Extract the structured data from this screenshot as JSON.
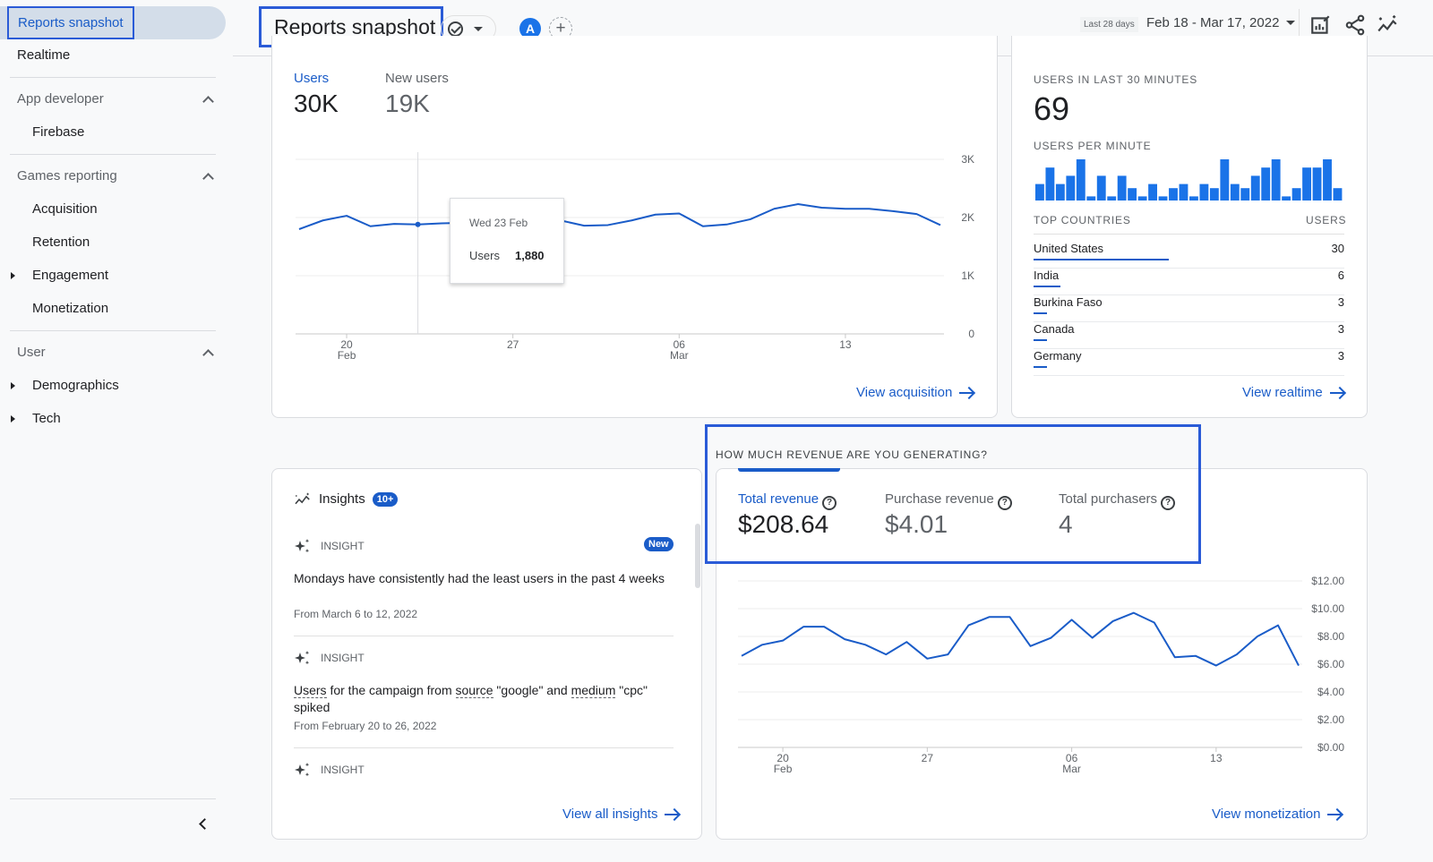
{
  "sidebar": {
    "active_item": "Reports snapshot",
    "realtime": "Realtime",
    "sections": [
      {
        "label": "App developer",
        "items": [
          "Firebase"
        ]
      },
      {
        "label": "Games reporting",
        "items": [
          "Acquisition",
          "Retention",
          "Engagement",
          "Monetization"
        ]
      },
      {
        "label": "User",
        "items": [
          "Demographics",
          "Tech"
        ]
      }
    ],
    "collapse_icon": "chevron-left-icon"
  },
  "header": {
    "title": "Reports snapshot",
    "avatar_letter": "A",
    "add_comparison": "+",
    "date_badge": "Last 28 days",
    "date_range": "Feb 18 - Mar 17, 2022",
    "icons": [
      "customize-report-icon",
      "share-icon",
      "insights-icon"
    ]
  },
  "users_card": {
    "metrics": [
      {
        "label": "Users",
        "value": "30K",
        "active": true
      },
      {
        "label": "New users",
        "value": "19K",
        "active": false
      }
    ],
    "tooltip": {
      "date": "Wed 23 Feb",
      "label": "Users",
      "value": "1,880"
    },
    "link": "View acquisition"
  },
  "realtime_card": {
    "title": "USERS IN LAST 30 MINUTES",
    "value": "69",
    "subtitle": "USERS PER MINUTE",
    "per_minute": [
      2,
      4,
      2,
      3,
      5,
      0.5,
      3,
      0.5,
      3,
      1.5,
      0.5,
      2,
      0.5,
      1.5,
      2,
      0.5,
      2,
      1.5,
      5,
      2,
      1.5,
      3,
      4,
      5,
      0.5,
      1.5,
      4,
      4,
      5,
      1.5
    ],
    "table_header": {
      "country": "TOP COUNTRIES",
      "users": "USERS"
    },
    "countries": [
      {
        "name": "United States",
        "users": "30",
        "share": 1.0
      },
      {
        "name": "India",
        "users": "6",
        "share": 0.2
      },
      {
        "name": "Burkina Faso",
        "users": "3",
        "share": 0.1
      },
      {
        "name": "Canada",
        "users": "3",
        "share": 0.1
      },
      {
        "name": "Germany",
        "users": "3",
        "share": 0.1
      }
    ],
    "link": "View realtime"
  },
  "insights_card": {
    "title": "Insights",
    "badge": "10+",
    "items": [
      {
        "kicker": "INSIGHT",
        "badge": "New",
        "text_parts": [
          {
            "t": "Mondays have consistently had the least users in the past 4 weeks",
            "dotted": false
          }
        ],
        "date": "From March 6 to 12, 2022"
      },
      {
        "kicker": "INSIGHT",
        "badge": "",
        "text_parts": [
          {
            "t": "Users",
            "dotted": true
          },
          {
            "t": " for the campaign from ",
            "dotted": false
          },
          {
            "t": "source",
            "dotted": true
          },
          {
            "t": " \"google\" and ",
            "dotted": false
          },
          {
            "t": "medium",
            "dotted": true
          },
          {
            "t": " \"cpc\" spiked",
            "dotted": false
          }
        ],
        "date": "From February 20 to 26, 2022"
      },
      {
        "kicker": "INSIGHT",
        "badge": "",
        "text_parts": [],
        "date": ""
      }
    ],
    "link": "View all insights"
  },
  "revenue_card": {
    "question": "HOW MUCH REVENUE ARE YOU GENERATING?",
    "metrics": [
      {
        "label": "Total revenue",
        "value": "$208.64",
        "active": true
      },
      {
        "label": "Purchase revenue",
        "value": "$4.01",
        "active": false
      },
      {
        "label": "Total purchasers",
        "value": "4",
        "active": false
      }
    ],
    "help_glyph": "?",
    "link": "View monetization"
  },
  "colors": {
    "accent": "#1a5cc8",
    "line": "#1a5cc8",
    "highlight_border": "#2a5bd7"
  },
  "chart_data": [
    {
      "type": "line",
      "title": "Users",
      "x": [
        "Feb 18",
        "Feb 19",
        "Feb 20",
        "Feb 21",
        "Feb 22",
        "Feb 23",
        "Feb 24",
        "Feb 25",
        "Feb 26",
        "Feb 27",
        "Feb 28",
        "Mar 01",
        "Mar 02",
        "Mar 03",
        "Mar 04",
        "Mar 05",
        "Mar 06",
        "Mar 07",
        "Mar 08",
        "Mar 09",
        "Mar 10",
        "Mar 11",
        "Mar 12",
        "Mar 13",
        "Mar 14",
        "Mar 15",
        "Mar 16",
        "Mar 17"
      ],
      "series": [
        {
          "name": "Users",
          "values": [
            1800,
            1950,
            2030,
            1850,
            1890,
            1880,
            1900,
            1910,
            1950,
            2080,
            1880,
            1950,
            1860,
            1870,
            1950,
            2050,
            2070,
            1850,
            1880,
            1970,
            2150,
            2230,
            2170,
            2150,
            2150,
            2110,
            2060,
            1870
          ]
        }
      ],
      "xticks": [
        {
          "label": "20",
          "sub": "Feb",
          "at": 2
        },
        {
          "label": "27",
          "sub": "",
          "at": 9
        },
        {
          "label": "06",
          "sub": "Mar",
          "at": 16
        },
        {
          "label": "13",
          "sub": "",
          "at": 23
        }
      ],
      "yticks": [
        "0",
        "1K",
        "2K",
        "3K"
      ],
      "ylim": [
        0,
        3000
      ],
      "highlight_index": 5,
      "grid": true
    },
    {
      "type": "line",
      "title": "Total revenue",
      "x": [
        "Feb 18",
        "Feb 19",
        "Feb 20",
        "Feb 21",
        "Feb 22",
        "Feb 23",
        "Feb 24",
        "Feb 25",
        "Feb 26",
        "Feb 27",
        "Feb 28",
        "Mar 01",
        "Mar 02",
        "Mar 03",
        "Mar 04",
        "Mar 05",
        "Mar 06",
        "Mar 07",
        "Mar 08",
        "Mar 09",
        "Mar 10",
        "Mar 11",
        "Mar 12",
        "Mar 13",
        "Mar 14",
        "Mar 15",
        "Mar 16",
        "Mar 17"
      ],
      "series": [
        {
          "name": "Total revenue",
          "values": [
            6.6,
            7.4,
            7.7,
            8.7,
            8.7,
            7.8,
            7.4,
            6.7,
            7.6,
            6.4,
            6.7,
            8.8,
            9.4,
            9.4,
            7.3,
            7.9,
            9.2,
            7.9,
            9.1,
            9.7,
            9.0,
            6.5,
            6.6,
            5.9,
            6.7,
            8.0,
            8.8,
            5.9
          ]
        }
      ],
      "xticks": [
        {
          "label": "20",
          "sub": "Feb",
          "at": 2
        },
        {
          "label": "27",
          "sub": "",
          "at": 9
        },
        {
          "label": "06",
          "sub": "Mar",
          "at": 16
        },
        {
          "label": "13",
          "sub": "",
          "at": 23
        }
      ],
      "yticks": [
        "$0.00",
        "$2.00",
        "$4.00",
        "$6.00",
        "$8.00",
        "$10.00",
        "$12.00"
      ],
      "ylim": [
        0,
        12
      ],
      "grid": true
    }
  ]
}
